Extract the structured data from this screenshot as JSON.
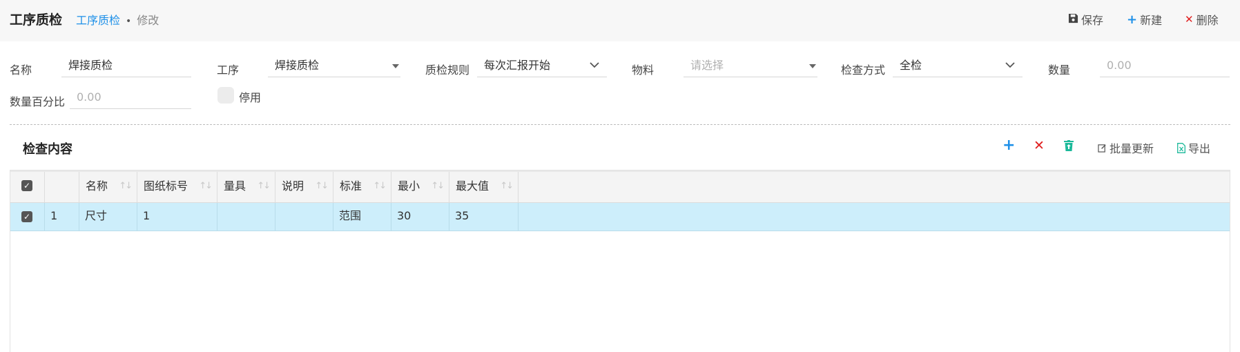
{
  "header": {
    "title": "工序质检",
    "breadcrumb_link": "工序质检",
    "breadcrumb_sep": "•",
    "breadcrumb_current": "修改",
    "save_label": "保存",
    "new_label": "新建",
    "delete_label": "删除"
  },
  "form": {
    "name_label": "名称",
    "name_value": "焊接质检",
    "process_label": "工序",
    "process_value": "焊接质检",
    "rule_label": "质检规则",
    "rule_value": "每次汇报开始",
    "material_label": "物料",
    "material_placeholder": "请选择",
    "method_label": "检查方式",
    "method_value": "全检",
    "qty_label": "数量",
    "qty_placeholder": "0.00",
    "qty_percent_label": "数量百分比",
    "qty_percent_placeholder": "0.00",
    "disable_label": "停用"
  },
  "section": {
    "title": "检查内容",
    "batch_update_label": "批量更新",
    "export_label": "导出"
  },
  "table": {
    "columns": [
      "名称",
      "图纸标号",
      "量具",
      "说明",
      "标准",
      "最小",
      "最大值"
    ],
    "rows": [
      {
        "index": "1",
        "name": "尺寸",
        "drawing_no": "1",
        "gauge": "",
        "note": "",
        "standard": "范围",
        "min": "30",
        "max": "35"
      }
    ]
  },
  "colors": {
    "accent": "#1e90e8",
    "danger": "#e02020",
    "selected_row": "#cdeefb",
    "trash": "#1bb99a"
  }
}
